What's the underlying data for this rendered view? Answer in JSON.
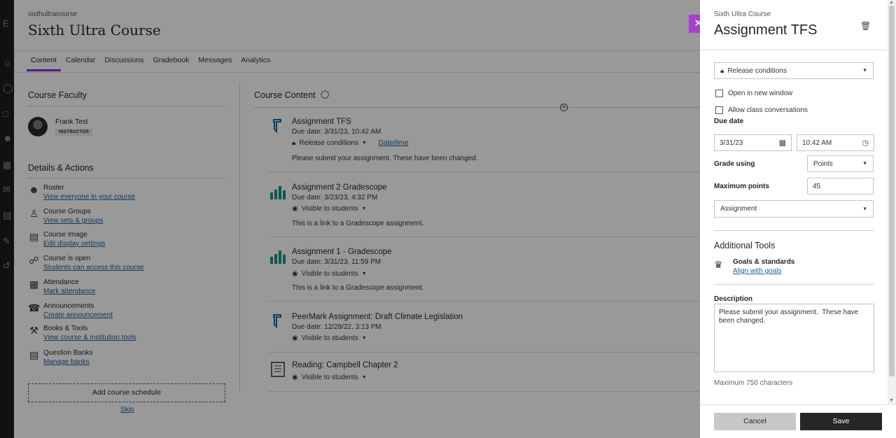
{
  "course": {
    "id": "sixthultracourse",
    "title": "Sixth Ultra Course"
  },
  "tabs": [
    "Content",
    "Calendar",
    "Discussions",
    "Gradebook",
    "Messages",
    "Analytics"
  ],
  "faculty": {
    "heading": "Course Faculty",
    "name": "Frank Test",
    "role": "INSTRUCTOR"
  },
  "details": {
    "heading": "Details & Actions",
    "items": [
      {
        "name": "Roster",
        "link": "View everyone in your course",
        "icon": "roster-icon"
      },
      {
        "name": "Course Groups",
        "link": "View sets & groups",
        "icon": "groups-icon"
      },
      {
        "name": "Course Image",
        "link": "Edit display settings",
        "icon": "image-icon"
      },
      {
        "name": "Course is open",
        "link": "Students can access this course",
        "icon": "unlock-icon"
      },
      {
        "name": "Attendance",
        "link": "Mark attendance",
        "icon": "attendance-icon"
      },
      {
        "name": "Announcements",
        "link": "Create announcement",
        "icon": "megaphone-icon"
      },
      {
        "name": "Books & Tools",
        "link": "View course & institution tools",
        "icon": "wrench-icon"
      },
      {
        "name": "Question Banks",
        "link": "Manage banks",
        "icon": "question-bank-icon"
      }
    ],
    "schedule_button": "Add course schedule",
    "skip": "Skip"
  },
  "content": {
    "heading": "Course Content",
    "items": [
      {
        "title": "Assignment TFS",
        "due": "Due date: 3/31/23, 10:42 AM",
        "visibility": "Release conditions",
        "extra_link": "Date/time",
        "desc": "Please submit your assignment. These have been changed.",
        "icon": "assignment-icon"
      },
      {
        "title": "Assignment 2 Gradescope",
        "due": "Due date: 3/23/23, 4:32 PM",
        "visibility": "Visible to students",
        "desc": "This is a link to a Gradescope assignment.",
        "icon": "bar-chart-icon"
      },
      {
        "title": "Assignment 1 - Gradescope",
        "due": "Due date: 3/31/23, 11:59 PM",
        "visibility": "Visible to students",
        "desc": "This is a link to a Gradescope assignment.",
        "icon": "bar-chart-icon"
      },
      {
        "title": "PeerMark Assignment: Draft Climate Legislation",
        "due": "Due date: 12/28/22, 3:13 PM",
        "visibility": "Visible to students",
        "icon": "assignment-icon"
      },
      {
        "title": "Reading: Campbell Chapter 2",
        "visibility": "Visible to students",
        "icon": "document-icon"
      }
    ]
  },
  "panel": {
    "course": "Sixth Ultra Course",
    "title": "Assignment TFS",
    "release": "Release conditions",
    "open_new_window": "Open in new window",
    "allow_conversations": "Allow class conversations",
    "due_label": "Due date",
    "due_date": "3/31/23",
    "due_time": "10:42 AM",
    "grade_using_label": "Grade using",
    "grade_using": "Points",
    "max_points_label": "Maximum points",
    "max_points": "45",
    "category": "Assignment",
    "additional_tools": "Additional Tools",
    "goals_title": "Goals & standards",
    "goals_link": "Align with goals",
    "description_label": "Description",
    "description": "Please submit your assignment.  These have been changed.",
    "max_chars": "Maximum 750 characters",
    "cancel": "Cancel",
    "save": "Save"
  },
  "colors": {
    "accent": "#8a2be2",
    "close_bg": "#a443c9",
    "link": "#1b5e9c",
    "gradescope": "#1a8f8a"
  }
}
